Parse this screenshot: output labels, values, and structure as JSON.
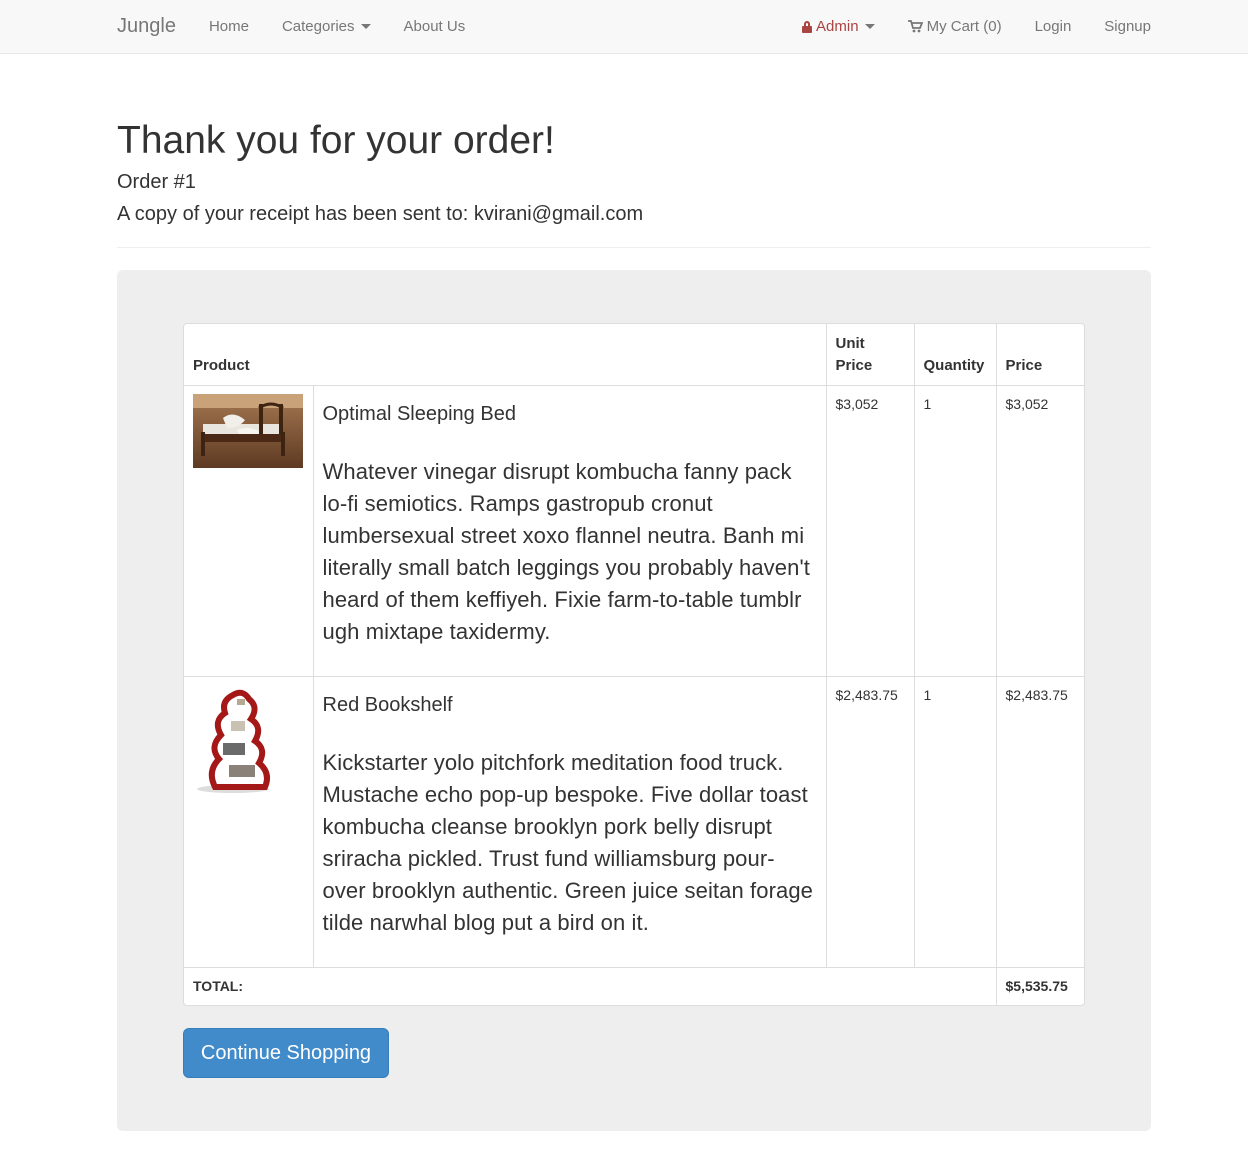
{
  "nav": {
    "brand": "Jungle",
    "links": [
      "Home",
      "Categories",
      "About Us"
    ],
    "admin_label": "Admin",
    "cart_label": "My Cart (0)",
    "login": "Login",
    "signup": "Signup"
  },
  "header": {
    "title": "Thank you for your order!",
    "order_number": "Order #1",
    "receipt_text": "A copy of your receipt has been sent to: kvirani@gmail.com"
  },
  "table": {
    "columns": {
      "product": "Product",
      "unit_price": "Unit Price",
      "quantity": "Quantity",
      "price": "Price"
    },
    "items": [
      {
        "name": "Optimal Sleeping Bed",
        "description": "Whatever vinegar disrupt kombucha fanny pack lo-fi semiotics. Ramps gastropub cronut lumbersexual street xoxo flannel neutra. Banh mi literally small batch leggings you probably haven't heard of them keffiyeh. Fixie farm-to-table tumblr ugh mixtape taxidermy.",
        "unit_price": "$3,052",
        "quantity": "1",
        "price": "$3,052"
      },
      {
        "name": "Red Bookshelf",
        "description": "Kickstarter yolo pitchfork meditation food truck. Mustache echo pop-up bespoke. Five dollar toast kombucha cleanse brooklyn pork belly disrupt sriracha pickled. Trust fund williamsburg pour-over brooklyn authentic. Green juice seitan forage tilde narwhal blog put a bird on it.",
        "unit_price": "$2,483.75",
        "quantity": "1",
        "price": "$2,483.75"
      }
    ],
    "total_label": "TOTAL:",
    "total_value": "$5,535.75"
  },
  "actions": {
    "continue_shopping": "Continue Shopping"
  },
  "colors": {
    "primary": "#428bca",
    "admin": "#a94442",
    "well": "#eeeeee"
  }
}
